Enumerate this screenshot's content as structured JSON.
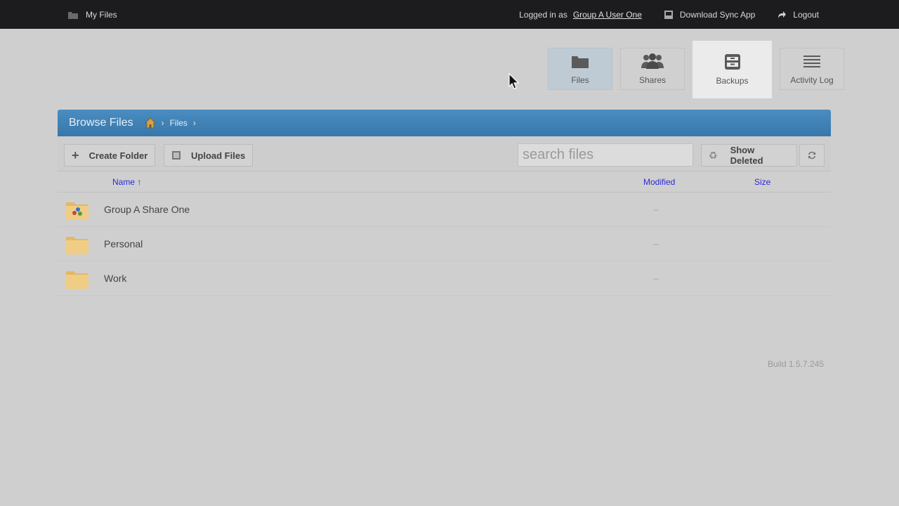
{
  "topbar": {
    "my_files": "My Files",
    "logged_in_prefix": "Logged in as",
    "user_name": "Group A User One",
    "download_sync": "Download Sync App",
    "logout": "Logout"
  },
  "nav": {
    "files": "Files",
    "shares": "Shares",
    "backups": "Backups",
    "activity_log": "Activity Log"
  },
  "panel": {
    "title": "Browse Files",
    "breadcrumb_files": "Files"
  },
  "toolbar": {
    "create_folder": "Create Folder",
    "upload_files": "Upload Files",
    "search_placeholder": "search files",
    "show_deleted": "Show Deleted"
  },
  "table": {
    "col_name": "Name ↑",
    "col_modified": "Modified",
    "col_size": "Size",
    "rows": [
      {
        "name": "Group A Share One",
        "modified": "--",
        "shared": true
      },
      {
        "name": "Personal",
        "modified": "--",
        "shared": false
      },
      {
        "name": "Work",
        "modified": "--",
        "shared": false
      }
    ]
  },
  "footer": {
    "build": "Build 1.5.7.245"
  },
  "colors": {
    "topbar_bg": "#1c1c1e",
    "panel_header": "#3f82b6",
    "link": "#2b2bd6"
  }
}
